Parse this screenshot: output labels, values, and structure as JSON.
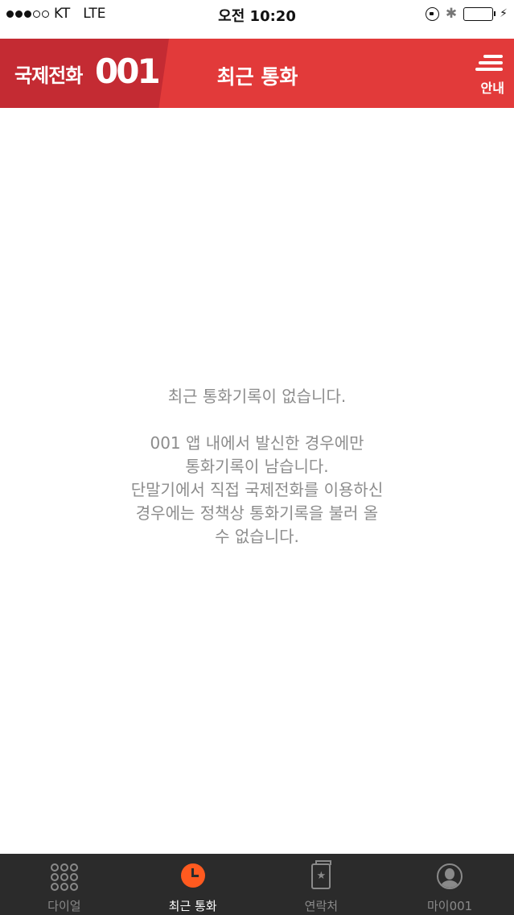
{
  "status_bar": {
    "carrier": "KT",
    "network": "LTE",
    "time": "오전 10:20",
    "signal_strength": 3,
    "signal_max": 5,
    "bluetooth_icon": "bluetooth-icon",
    "battery_level": 1.0
  },
  "header": {
    "brand_text": "국제전화",
    "brand_logo": "001",
    "title": "최근 통화",
    "menu_label": "안내",
    "colors": {
      "primary": "#e23a3a",
      "brand_bg": "#c42b33"
    }
  },
  "empty_state": {
    "title": "최근 통화기록이 없습니다.",
    "lines": [
      "001 앱 내에서 발신한 경우에만",
      "통화기록이 남습니다.",
      "단말기에서 직접 국제전화를 이용하신",
      "경우에는 정책상 통화기록을 불러 올",
      "수 없습니다."
    ]
  },
  "tabs": [
    {
      "label": "다이얼",
      "icon": "dialpad-icon",
      "active": false
    },
    {
      "label": "최근 통화",
      "icon": "clock-icon",
      "active": true
    },
    {
      "label": "연락처",
      "icon": "contacts-book-icon",
      "active": false
    },
    {
      "label": "마이001",
      "icon": "profile-icon",
      "active": false
    }
  ],
  "accent_color": "#ff5a1f"
}
